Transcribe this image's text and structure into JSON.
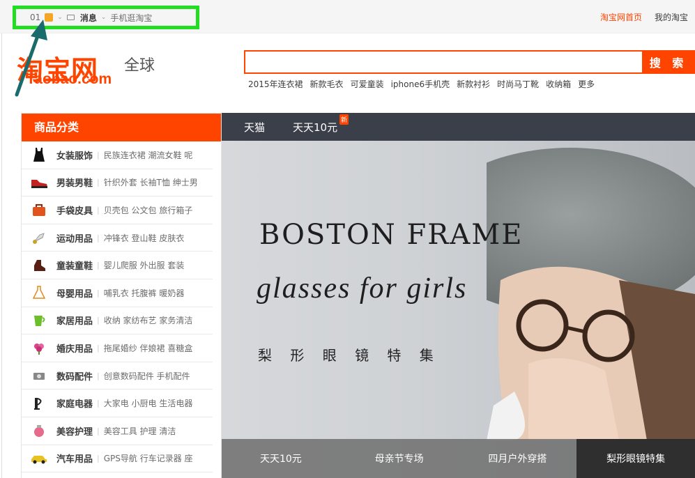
{
  "topbar": {
    "user_label": "01",
    "message_label": "消息",
    "mobile_label": "手机逛淘宝",
    "home_link": "淘宝网首页",
    "my_taobao": "我的淘宝"
  },
  "logo": {
    "cn": "淘宝网",
    "en": "Taobao.com",
    "global": "全球"
  },
  "search": {
    "value": "",
    "button_label": "搜 索",
    "hotwords": [
      "2015年连衣裙",
      "新款毛衣",
      "可爱童装",
      "iphone6手机壳",
      "新款衬衫",
      "时尚马丁靴",
      "收纳箱",
      "更多"
    ]
  },
  "categories": {
    "title": "商品分类",
    "items": [
      {
        "name": "女装服饰",
        "sub": "民族连衣裙 潮流女鞋 呢",
        "icon": "dress-icon"
      },
      {
        "name": "男装男鞋",
        "sub": "针织外套 长袖T恤 绅士男",
        "icon": "shoe-icon"
      },
      {
        "name": "手袋皮具",
        "sub": "贝壳包 公文包 旅行箱子",
        "icon": "bag-icon"
      },
      {
        "name": "运动用品",
        "sub": "冲锋衣 登山鞋 皮肤衣",
        "icon": "badminton-icon"
      },
      {
        "name": "童装童鞋",
        "sub": "婴儿爬服 外出服 套装",
        "icon": "kids-shoe-icon"
      },
      {
        "name": "母婴用品",
        "sub": "哺乳衣 托腹裤 暖奶器",
        "icon": "baby-bottle-icon"
      },
      {
        "name": "家居用品",
        "sub": "收纳 家纺布艺 家务清洁",
        "icon": "cup-icon"
      },
      {
        "name": "婚庆用品",
        "sub": "拖尾婚纱 伴娘裙 喜糖盒",
        "icon": "flower-icon"
      },
      {
        "name": "数码配件",
        "sub": "创意数码配件 手机配件",
        "icon": "camera-icon"
      },
      {
        "name": "家庭电器",
        "sub": "大家电 小厨电 生活电器",
        "icon": "appliance-icon"
      },
      {
        "name": "美容护理",
        "sub": "美容工具 护理 清洁",
        "icon": "cosmetics-icon"
      },
      {
        "name": "汽车用品",
        "sub": "GPS导航 行车记录器 座",
        "icon": "car-icon"
      }
    ]
  },
  "nav": {
    "tabs": [
      "天猫",
      "天天10元"
    ],
    "badge": "新"
  },
  "banner": {
    "title": "BOSTON FRAME",
    "subtitle": "glasses for girls",
    "cn_title": "梨 形 眼 镜 特 集",
    "tabs": [
      "天天10元",
      "母亲节专场",
      "四月户外穿搭",
      "梨形眼镜特集"
    ]
  },
  "colors": {
    "brand": "#ff4400",
    "highlight_box": "#22dd22",
    "arrow": "#1a6b6b"
  }
}
